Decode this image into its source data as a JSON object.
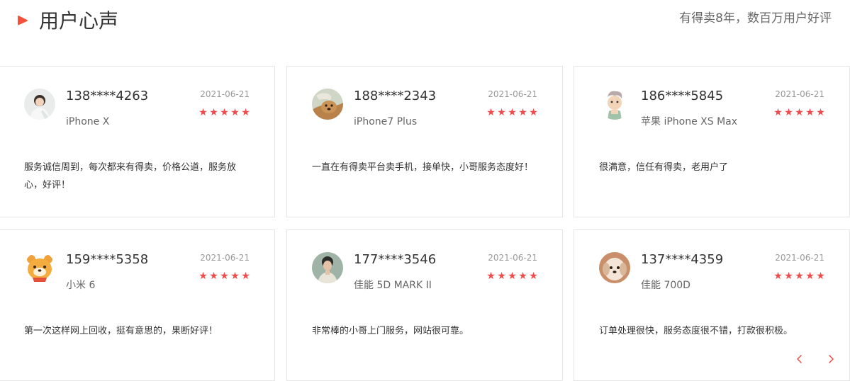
{
  "header": {
    "title": "用户心声",
    "subtitle": "有得卖8年，数百万用户好评",
    "accent_color": "#f5503a"
  },
  "reviews": [
    {
      "phone": "138****4263",
      "model": "iPhone X",
      "date": "2021-06-21",
      "rating": 5,
      "comment": "服务诚信周到，每次都来有得卖，价格公道，服务放心，好评！",
      "avatar": "avatar-person-photo"
    },
    {
      "phone": "188****2343",
      "model": "iPhone7 Plus",
      "date": "2021-06-21",
      "rating": 5,
      "comment": "一直在有得卖平台卖手机，接单快，小哥服务态度好！",
      "avatar": "avatar-dog-photo"
    },
    {
      "phone": "186****5845",
      "model": "苹果 iPhone XS Max",
      "date": "2021-06-21",
      "rating": 5,
      "comment": "很满意，信任有得卖，老用户了",
      "avatar": "avatar-cartoon-figure"
    },
    {
      "phone": "159****5358",
      "model": "小米 6",
      "date": "2021-06-21",
      "rating": 5,
      "comment": "第一次这样网上回收，挺有意思的，果断好评！",
      "avatar": "avatar-cartoon-bear"
    },
    {
      "phone": "177****3546",
      "model": "佳能 5D MARK II",
      "date": "2021-06-21",
      "rating": 5,
      "comment": "非常棒的小哥上门服务，网站很可靠。",
      "avatar": "avatar-person-photo"
    },
    {
      "phone": "137****4359",
      "model": "佳能 700D",
      "date": "2021-06-21",
      "rating": 5,
      "comment": "订单处理很快，服务态度很不错，打款很积极。",
      "avatar": "avatar-puppy-photo"
    }
  ],
  "star_color": "#f14a4a",
  "nav": {
    "prev_icon": "chevron-left-icon",
    "next_icon": "chevron-right-icon",
    "color": "#e8413b"
  }
}
